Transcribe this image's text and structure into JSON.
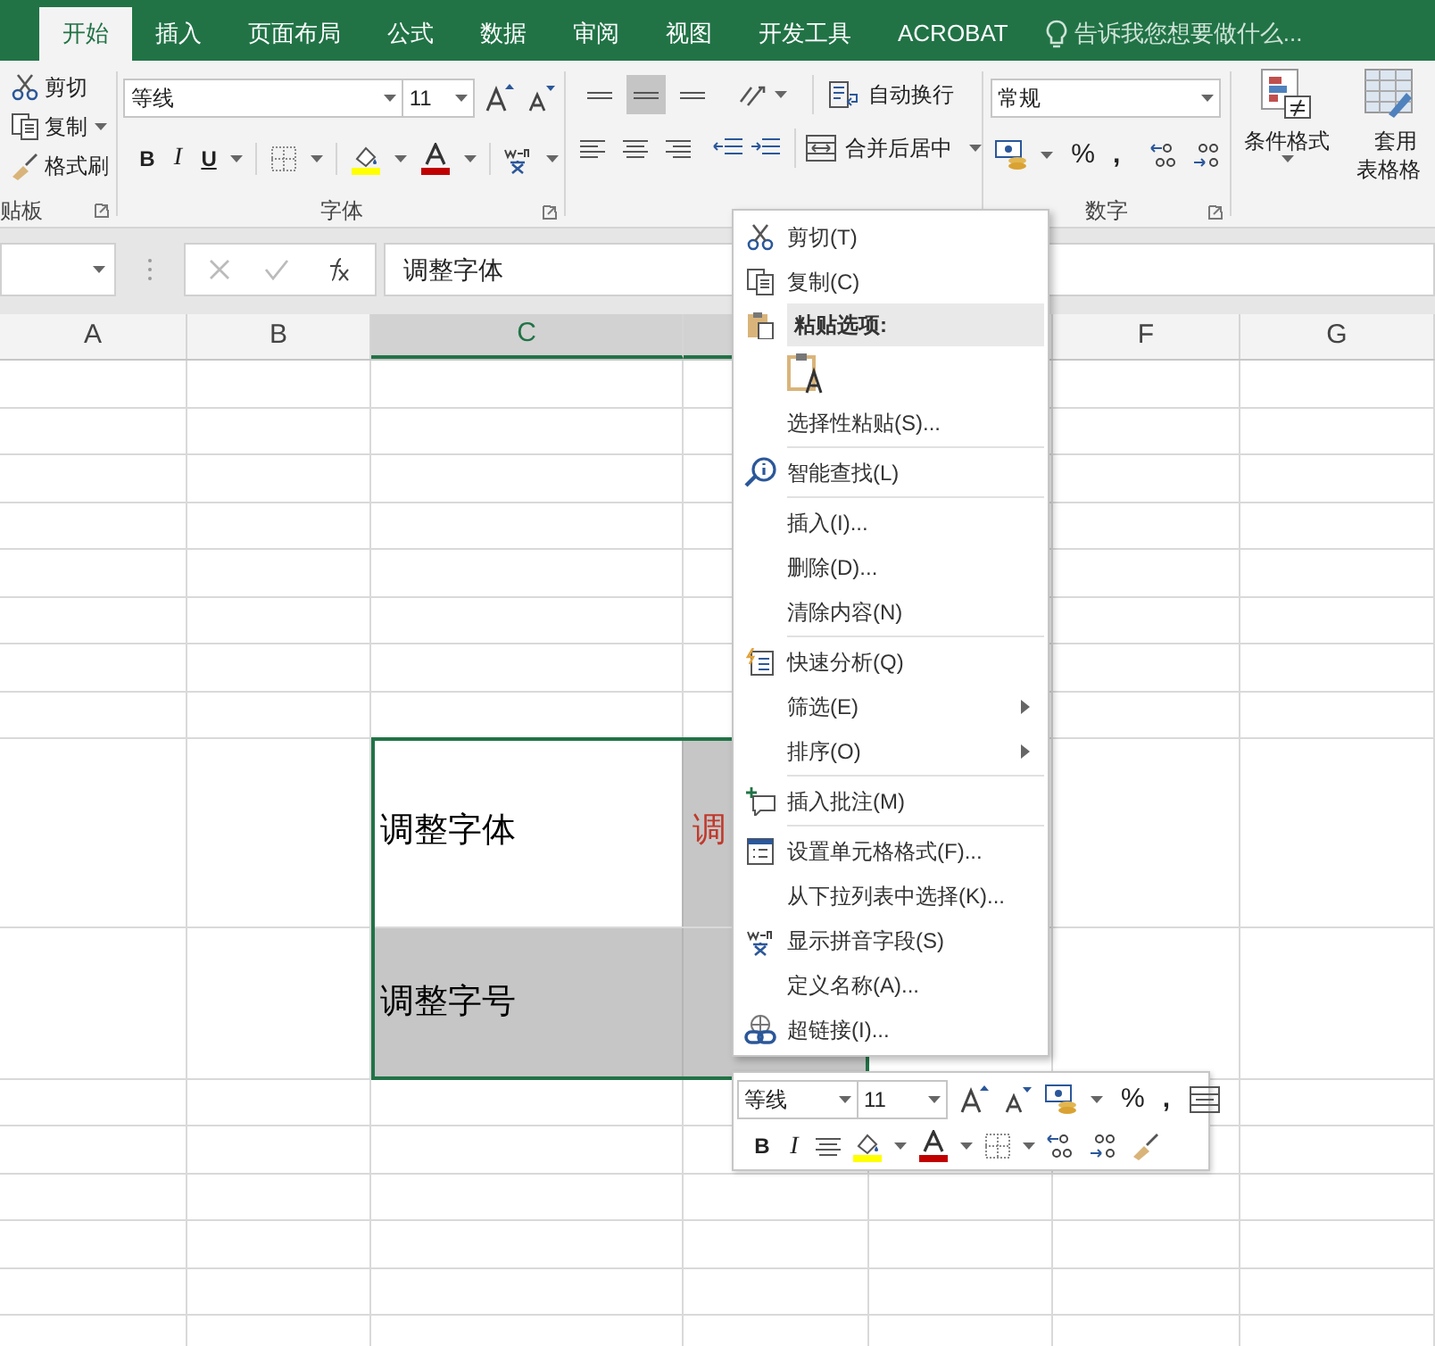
{
  "tabs": [
    {
      "label": "开始",
      "selected": true
    },
    {
      "label": "插入",
      "selected": false
    },
    {
      "label": "页面布局",
      "selected": false
    },
    {
      "label": "公式",
      "selected": false
    },
    {
      "label": "数据",
      "selected": false
    },
    {
      "label": "审阅",
      "selected": false
    },
    {
      "label": "视图",
      "selected": false
    },
    {
      "label": "开发工具",
      "selected": false
    },
    {
      "label": "ACROBAT",
      "selected": false
    }
  ],
  "tell_me": {
    "placeholder": "告诉我您想要做什么..."
  },
  "ribbon": {
    "clipboard": {
      "cut": "剪切",
      "copy": "复制",
      "format_painter": "格式刷",
      "label": "贴板"
    },
    "font": {
      "font_name": "等线",
      "font_size": "11",
      "bold": "B",
      "italic": "I",
      "underline": "U",
      "label": "字体"
    },
    "alignment": {
      "vertical": [
        {
          "selected": false
        },
        {
          "selected": true
        },
        {
          "selected": false
        }
      ],
      "wrap_text": "自动换行",
      "merge_center": "合并后居中"
    },
    "number": {
      "format": "常规",
      "percent": "%",
      "comma": ",",
      "label": "数字"
    },
    "styles": {
      "conditional_formatting": "条件格式",
      "format_as_table": [
        "套用",
        "表格格"
      ]
    }
  },
  "formula_bar": {
    "formula": "调整字体"
  },
  "columns": [
    {
      "label": "A",
      "selected": false
    },
    {
      "label": "B",
      "selected": false
    },
    {
      "label": "C",
      "selected": true
    },
    {
      "selected": true
    },
    {
      "selected": false
    },
    {
      "label": "F",
      "selected": false
    },
    {
      "label": "G",
      "selected": false
    }
  ],
  "selected_range": [
    {
      "text": "调整字体",
      "active": true,
      "color": "#000000"
    },
    {
      "text": "调",
      "active": false,
      "color": "#c0392b"
    },
    {
      "text": "调整字号",
      "active": false,
      "color": "#000000"
    },
    {
      "active": false
    }
  ],
  "context_menu": [
    {
      "kind": "item",
      "label": "剪切(T)",
      "submenu": false
    },
    {
      "kind": "item",
      "label": "复制(C)",
      "submenu": false
    },
    {
      "kind": "header",
      "label": "粘贴选项:"
    },
    {
      "kind": "paste_option"
    },
    {
      "kind": "item",
      "label": "选择性粘贴(S)...",
      "submenu": false
    },
    {
      "kind": "separator"
    },
    {
      "kind": "item",
      "label": "智能查找(L)",
      "submenu": false
    },
    {
      "kind": "separator"
    },
    {
      "kind": "item",
      "label": "插入(I)...",
      "submenu": false
    },
    {
      "kind": "item",
      "label": "删除(D)...",
      "submenu": false
    },
    {
      "kind": "item",
      "label": "清除内容(N)",
      "submenu": false
    },
    {
      "kind": "separator"
    },
    {
      "kind": "item",
      "label": "快速分析(Q)",
      "submenu": false
    },
    {
      "kind": "item",
      "label": "筛选(E)",
      "submenu": true
    },
    {
      "kind": "item",
      "label": "排序(O)",
      "submenu": true
    },
    {
      "kind": "separator"
    },
    {
      "kind": "item",
      "label": "插入批注(M)",
      "submenu": false
    },
    {
      "kind": "separator"
    },
    {
      "kind": "item",
      "label": "设置单元格格式(F)...",
      "submenu": false
    },
    {
      "kind": "item",
      "label": "从下拉列表中选择(K)...",
      "submenu": false
    },
    {
      "kind": "item",
      "label": "显示拼音字段(S)",
      "submenu": false
    },
    {
      "kind": "item",
      "label": "定义名称(A)...",
      "submenu": false
    },
    {
      "kind": "item",
      "label": "超链接(I)...",
      "submenu": false
    }
  ],
  "mini_toolbar": {
    "font_name": "等线",
    "font_size": "11",
    "percent": "%",
    "comma": ",",
    "bold": "B",
    "italic": "I"
  }
}
